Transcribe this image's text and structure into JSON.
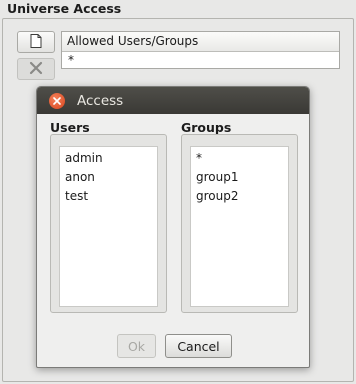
{
  "panel": {
    "title": "Universe Access",
    "toolbar": {
      "add_icon": "document-new-icon",
      "delete_icon": "close-x-icon"
    },
    "table": {
      "header": "Allowed Users/Groups",
      "rows": [
        "*"
      ]
    }
  },
  "dialog": {
    "title": "Access",
    "users": {
      "label": "Users",
      "items": [
        "admin",
        "anon",
        "test"
      ]
    },
    "groups": {
      "label": "Groups",
      "items": [
        "*",
        "group1",
        "group2"
      ]
    },
    "buttons": {
      "ok": "Ok",
      "cancel": "Cancel"
    }
  }
}
